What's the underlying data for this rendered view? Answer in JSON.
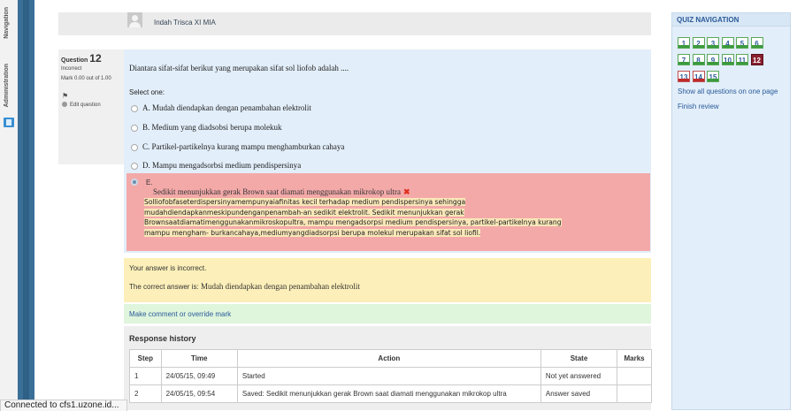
{
  "dock": {
    "navigation_label": "Navigation",
    "administration_label": "Administration"
  },
  "user": {
    "name": "Indah Trisca XI MIA"
  },
  "question_info": {
    "label": "Question",
    "number": "12",
    "state": "Incorrect",
    "mark": "Mark 0.00 out of 1.00",
    "flag_icon": "flag-icon",
    "edit_label": "Edit question"
  },
  "question": {
    "text": "Diantara sifat-sifat berikut yang merupakan sifat sol liofob adalah ....",
    "prompt": "Select one:",
    "options": [
      {
        "label": "A. Mudah diendapkan dengan penambahan elektrolit"
      },
      {
        "label": "B. Medium yang diadsobsi berupa molekuk"
      },
      {
        "label": "C. Partikel-partikelnya kurang mampu menghamburkan cahaya"
      },
      {
        "label": "D. Mampu mengadsorbsi medium pendispersinya"
      }
    ],
    "selected": {
      "letter": "E.",
      "title": "Sedikit menunjukkan gerak Brown saat diamati menggunakan mikrokop ultra",
      "body_lines": [
        "Solliofobfaseterdispersinyamempunyaiafinitas kecil terhadap medium pendispersinya sehingga",
        "mudahdiendapkanmeskipundenganpenambah-an sedikit elektrolit. Sedikit menunjukkan gerak",
        "Brownsaatdiamatimenggunakanmikroskopultra, mampu mengadsorpsi medium pendispersinya, partikel-partikelnya kurang",
        "mampu mengham- burkancahaya,mediumyangdiadsorpsi berupa molekul merupakan sifat sol liofil."
      ]
    }
  },
  "feedback": {
    "incorrect_text": "Your answer is incorrect.",
    "correct_prefix": "The correct answer is:",
    "correct_answer": "Mudah diendapkan dengan penambahan elektrolit"
  },
  "comment_link": "Make comment or override mark",
  "history": {
    "title": "Response history",
    "headers": [
      "Step",
      "Time",
      "Action",
      "State",
      "Marks"
    ],
    "rows": [
      {
        "step": "1",
        "time": "24/05/15, 09:49",
        "action": "Started",
        "state": "Not yet answered",
        "marks": ""
      },
      {
        "step": "2",
        "time": "24/05/15, 09:54",
        "action": "Saved: Sedikit menunjukkan gerak Brown saat diamati menggunakan mikrokop ultra",
        "state": "Answer saved",
        "marks": ""
      }
    ]
  },
  "quiz_navigation": {
    "title": "QUIZ NAVIGATION",
    "buttons": [
      {
        "label": "1",
        "status": "correct"
      },
      {
        "label": "2",
        "status": "correct"
      },
      {
        "label": "3",
        "status": "correct"
      },
      {
        "label": "4",
        "status": "correct"
      },
      {
        "label": "5",
        "status": "correct"
      },
      {
        "label": "6",
        "status": "correct"
      },
      {
        "label": "7",
        "status": "correct"
      },
      {
        "label": "8",
        "status": "correct"
      },
      {
        "label": "9",
        "status": "correct"
      },
      {
        "label": "10",
        "status": "correct"
      },
      {
        "label": "11",
        "status": "correct"
      },
      {
        "label": "12",
        "status": "current"
      },
      {
        "label": "13",
        "status": "incorrect"
      },
      {
        "label": "14",
        "status": "incorrect"
      },
      {
        "label": "15",
        "status": "correct"
      }
    ],
    "show_all_link": "Show all questions on one page",
    "finish_link": "Finish review"
  },
  "status_bar": "Connected to cfs1.uzone.id...",
  "colors": {
    "formulation_bg": "#e2eef9",
    "incorrect_bg": "#f4a9a9",
    "feedback_bg": "#fcefb9",
    "comment_bg": "#dff5dc",
    "current_question": "#8a1f2e",
    "link": "#2a5a9a"
  }
}
